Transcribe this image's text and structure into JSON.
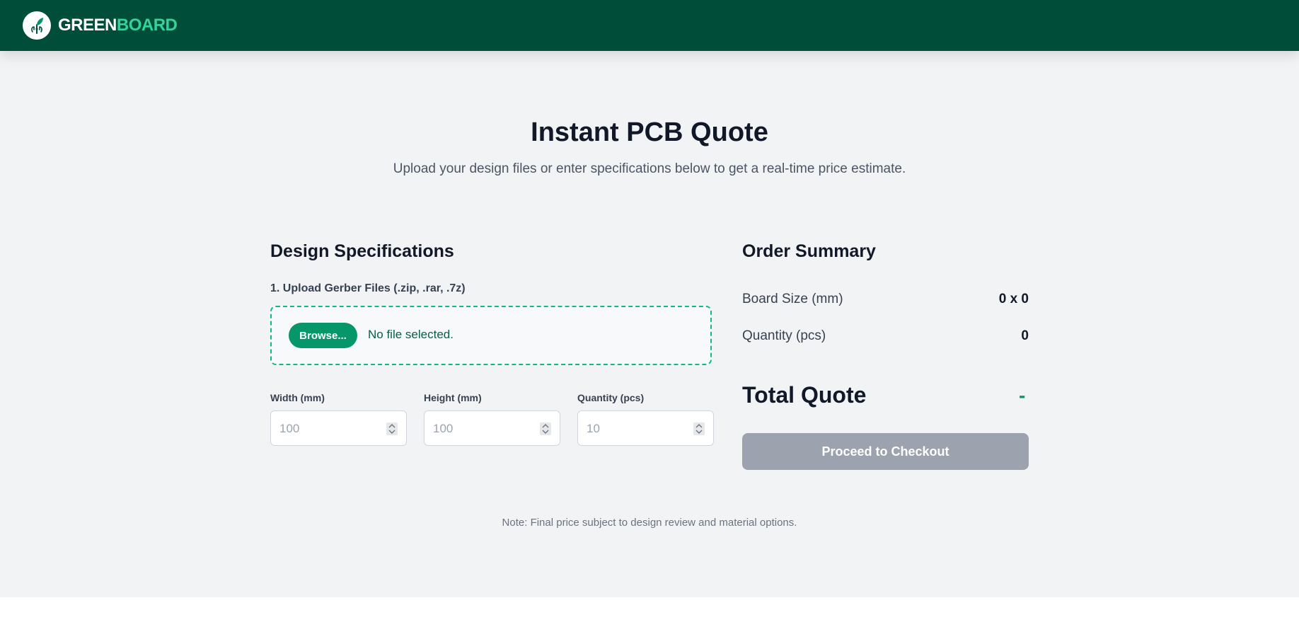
{
  "brand": {
    "name_part1": "GREEN",
    "name_part2": "BOARD"
  },
  "page": {
    "title": "Instant PCB Quote",
    "subtitle": "Upload your design files or enter specifications below to get a real-time price estimate."
  },
  "design": {
    "heading": "Design Specifications",
    "upload_label": "1. Upload Gerber Files (.zip, .rar, .7z)",
    "browse_label": "Browse...",
    "file_status": "No file selected.",
    "fields": [
      {
        "label": "Width (mm)",
        "placeholder": "100"
      },
      {
        "label": "Height (mm)",
        "placeholder": "100"
      },
      {
        "label": "Quantity (pcs)",
        "placeholder": "10"
      }
    ]
  },
  "summary": {
    "heading": "Order Summary",
    "rows": [
      {
        "label": "Board Size (mm)",
        "value": "0 x 0"
      },
      {
        "label": "Quantity (pcs)",
        "value": "0"
      }
    ],
    "total_label": "Total Quote",
    "total_value": "-",
    "checkout_label": "Proceed to Checkout"
  },
  "note": "Note: Final price subject to design review and material options.",
  "colors": {
    "header_bg": "#004d3a",
    "accent": "#059669",
    "accent_light": "#34d399",
    "disabled_button": "#9ca3af"
  },
  "icons": {
    "logo": "leaf-circuit-icon",
    "spinner": "spin-arrows-icon"
  }
}
